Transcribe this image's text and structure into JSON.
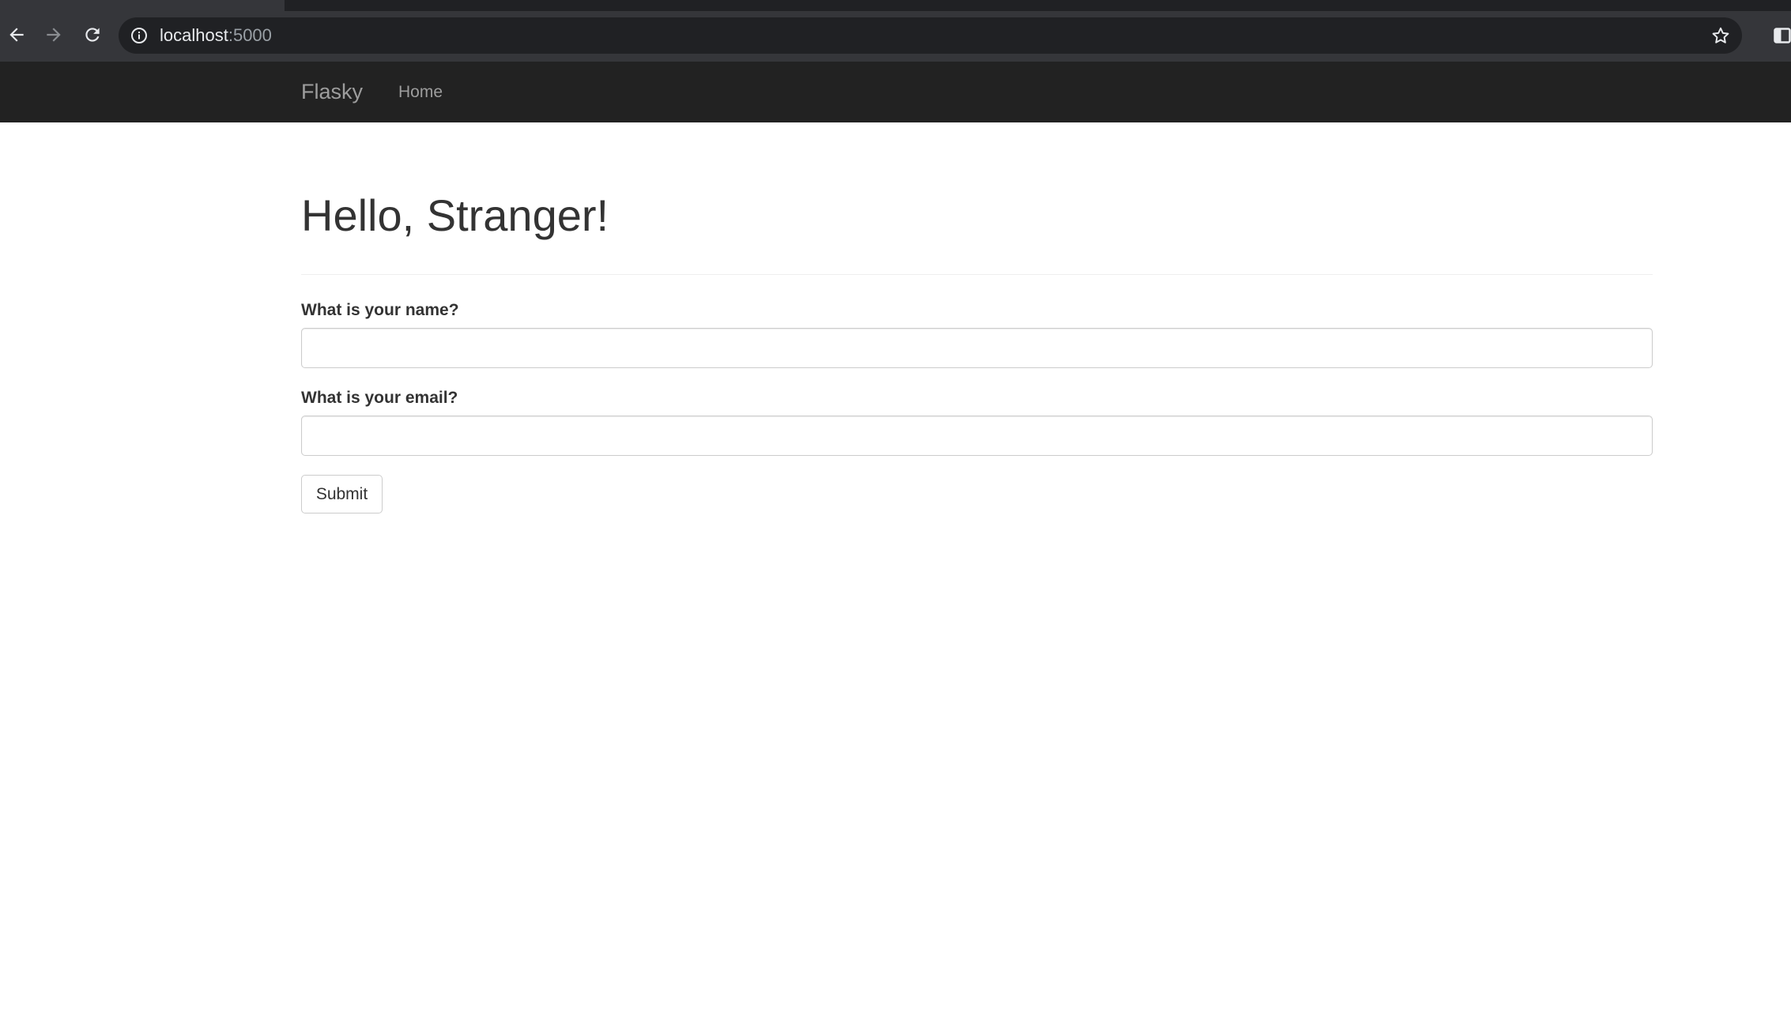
{
  "browser": {
    "url_host": "localhost",
    "url_port": ":5000",
    "icons": {
      "back": "back-arrow-icon",
      "forward": "forward-arrow-icon",
      "reload": "reload-icon",
      "info": "info-icon",
      "bookmark": "star-icon",
      "side_panel": "side-panel-icon"
    }
  },
  "navbar": {
    "brand": "Flasky",
    "items": [
      {
        "label": "Home"
      }
    ]
  },
  "page": {
    "title": "Hello, Stranger!"
  },
  "form": {
    "name_label": "What is your name?",
    "name_value": "",
    "email_label": "What is your email?",
    "email_value": "",
    "submit_label": "Submit"
  },
  "colors": {
    "navbar_bg": "#222222",
    "navbar_text": "#9d9d9d",
    "heading_text": "#333333",
    "chrome_bg": "#35363a",
    "omnibox_bg": "#202124"
  }
}
